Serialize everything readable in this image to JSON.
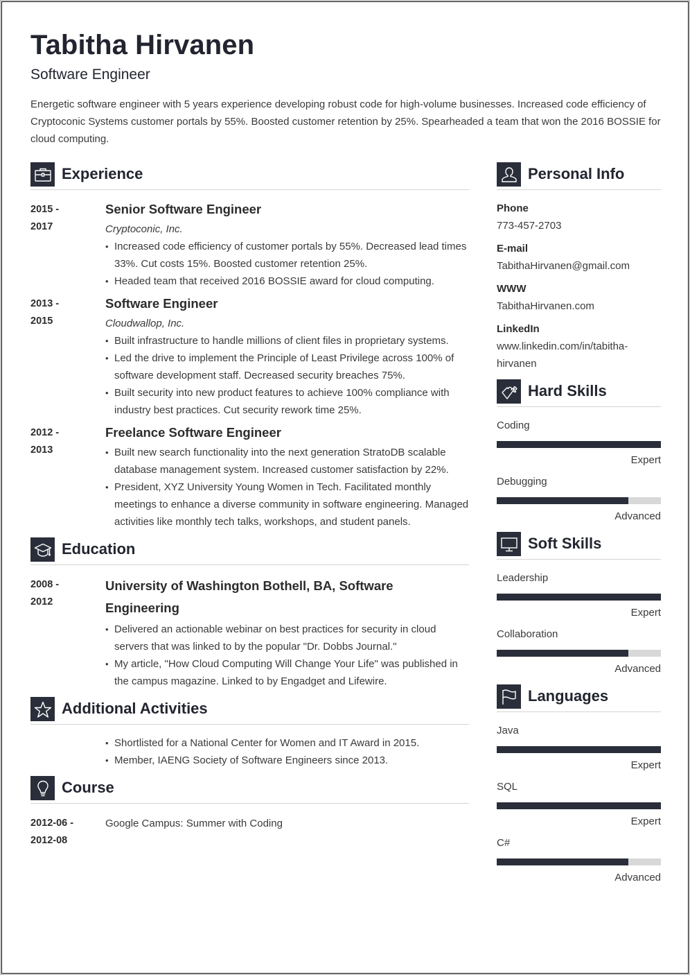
{
  "header": {
    "name": "Tabitha Hirvanen",
    "title": "Software Engineer",
    "summary": "Energetic software engineer with 5 years experience developing robust code for high-volume businesses. Increased code efficiency of Cryptoconic Systems customer portals by 55%. Boosted customer retention by 25%. Spearheaded a team that won the 2016 BOSSIE for cloud computing."
  },
  "theme": {
    "accent": "#2a2e3a",
    "bar_track": "#d8d8d8",
    "divider": "#d4d4d4"
  },
  "experience": {
    "title": "Experience",
    "icon": "briefcase-icon",
    "entries": [
      {
        "date_start": "2015 -",
        "date_end": "2017",
        "role": "Senior Software Engineer",
        "company": "Cryptoconic, Inc.",
        "bullets": [
          "Increased code efficiency of customer portals by 55%. Decreased lead times 33%. Cut costs 15%. Boosted customer retention 25%.",
          "Headed team that received 2016 BOSSIE award for cloud computing."
        ]
      },
      {
        "date_start": "2013 -",
        "date_end": "2015",
        "role": "Software Engineer",
        "company": "Cloudwallop, Inc.",
        "bullets": [
          "Built infrastructure to handle millions of client files in proprietary systems.",
          "Led the drive to implement the Principle of Least Privilege across 100% of software development staff. Decreased security breaches 75%.",
          "Built security into new product features to achieve 100% compliance with industry best practices. Cut security rework time 25%."
        ]
      },
      {
        "date_start": "2012 -",
        "date_end": "2013",
        "role": "Freelance Software Engineer",
        "bullets": [
          "Built new search functionality into the next generation StratoDB scalable database management system. Increased customer satisfaction by 22%.",
          "President, XYZ University Young Women in Tech. Facilitated monthly meetings to enhance a diverse community in software engineering. Managed activities like monthly tech talks, workshops, and student panels."
        ]
      }
    ]
  },
  "education": {
    "title": "Education",
    "icon": "graduation-cap-icon",
    "entries": [
      {
        "date_start": "2008 -",
        "date_end": "2012",
        "degree": "University of Washington Bothell, BA, Software Engineering",
        "bullets": [
          "Delivered an actionable webinar on best practices for security in cloud servers that was linked to by the popular \"Dr. Dobbs Journal.\"",
          "My article, \"How Cloud Computing Will Change Your Life\" was published in the campus magazine. Linked to by Engadget and Lifewire."
        ]
      }
    ]
  },
  "activities": {
    "title": "Additional Activities",
    "icon": "star-icon",
    "bullets": [
      "Shortlisted for a National Center for Women and IT Award in 2015.",
      "Member, IAENG Society of Software Engineers since 2013."
    ]
  },
  "course": {
    "title": "Course",
    "icon": "lightbulb-icon",
    "entries": [
      {
        "date_start": "2012-06 -",
        "date_end": "2012-08",
        "name": "Google Campus: Summer with Coding"
      }
    ]
  },
  "personal_info": {
    "title": "Personal Info",
    "icon": "person-icon",
    "fields": [
      {
        "label": "Phone",
        "value": "773-457-2703"
      },
      {
        "label": "E-mail",
        "value": "TabithaHirvanen@gmail.com"
      },
      {
        "label": "WWW",
        "value": "TabithaHirvanen.com"
      },
      {
        "label": "LinkedIn",
        "value": "www.linkedin.com/in/tabitha-hirvanen"
      }
    ]
  },
  "hard_skills": {
    "title": "Hard Skills",
    "icon": "puzzle-piece-icon",
    "items": [
      {
        "name": "Coding",
        "level": "Expert",
        "fill_percent": 100
      },
      {
        "name": "Debugging",
        "level": "Advanced",
        "fill_percent": 80
      }
    ]
  },
  "soft_skills": {
    "title": "Soft Skills",
    "icon": "monitor-icon",
    "items": [
      {
        "name": "Leadership",
        "level": "Expert",
        "fill_percent": 100
      },
      {
        "name": "Collaboration",
        "level": "Advanced",
        "fill_percent": 80
      }
    ]
  },
  "languages": {
    "title": "Languages",
    "icon": "flag-icon",
    "items": [
      {
        "name": "Java",
        "level": "Expert",
        "fill_percent": 100
      },
      {
        "name": "SQL",
        "level": "Expert",
        "fill_percent": 100
      },
      {
        "name": "C#",
        "level": "Advanced",
        "fill_percent": 80
      }
    ]
  }
}
